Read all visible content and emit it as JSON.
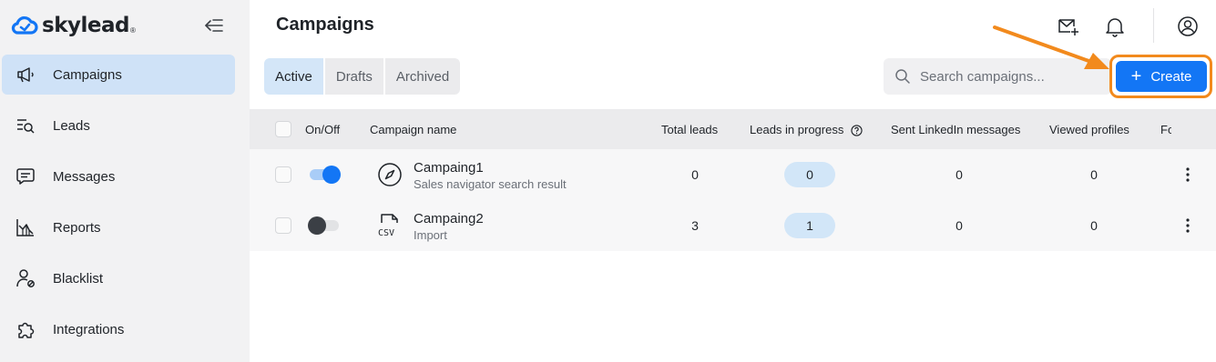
{
  "brand": {
    "name": "skylead",
    "mark": "®"
  },
  "sidebar": {
    "items": [
      {
        "label": "Campaigns",
        "icon": "megaphone-icon",
        "active": true
      },
      {
        "label": "Leads",
        "icon": "leads-list-search-icon"
      },
      {
        "label": "Messages",
        "icon": "message-icon"
      },
      {
        "label": "Reports",
        "icon": "chart-icon"
      },
      {
        "label": "Blacklist",
        "icon": "user-blocked-icon"
      },
      {
        "label": "Integrations",
        "icon": "puzzle-icon"
      }
    ]
  },
  "header": {
    "title": "Campaigns",
    "icons": [
      "mail-plus-icon",
      "bell-icon",
      "user-circle-icon"
    ]
  },
  "tabs": [
    {
      "label": "Active",
      "active": true
    },
    {
      "label": "Drafts"
    },
    {
      "label": "Archived"
    }
  ],
  "search": {
    "placeholder": "Search campaigns..."
  },
  "create_button": {
    "label": "Create"
  },
  "table": {
    "headers": {
      "on_off": "On/Off",
      "campaign_name": "Campaign name",
      "total_leads": "Total leads",
      "leads_in_progress": "Leads in progress",
      "sent_linkedin": "Sent LinkedIn messages",
      "viewed_profiles": "Viewed profiles",
      "truncated": "Fo"
    },
    "rows": [
      {
        "name": "Campaing1",
        "source": "Sales navigator search result",
        "source_icon": "compass-icon",
        "on": true,
        "total_leads": "0",
        "in_progress": "0",
        "sent_linkedin": "0",
        "viewed_profiles": "0"
      },
      {
        "name": "Campaing2",
        "source": "Import",
        "source_icon": "csv-file-icon",
        "on": false,
        "total_leads": "3",
        "in_progress": "1",
        "sent_linkedin": "0",
        "viewed_profiles": "0"
      }
    ]
  },
  "colors": {
    "accent": "#1376f5",
    "active_bg": "#cfe2f7",
    "highlight": "#f28a1d"
  }
}
